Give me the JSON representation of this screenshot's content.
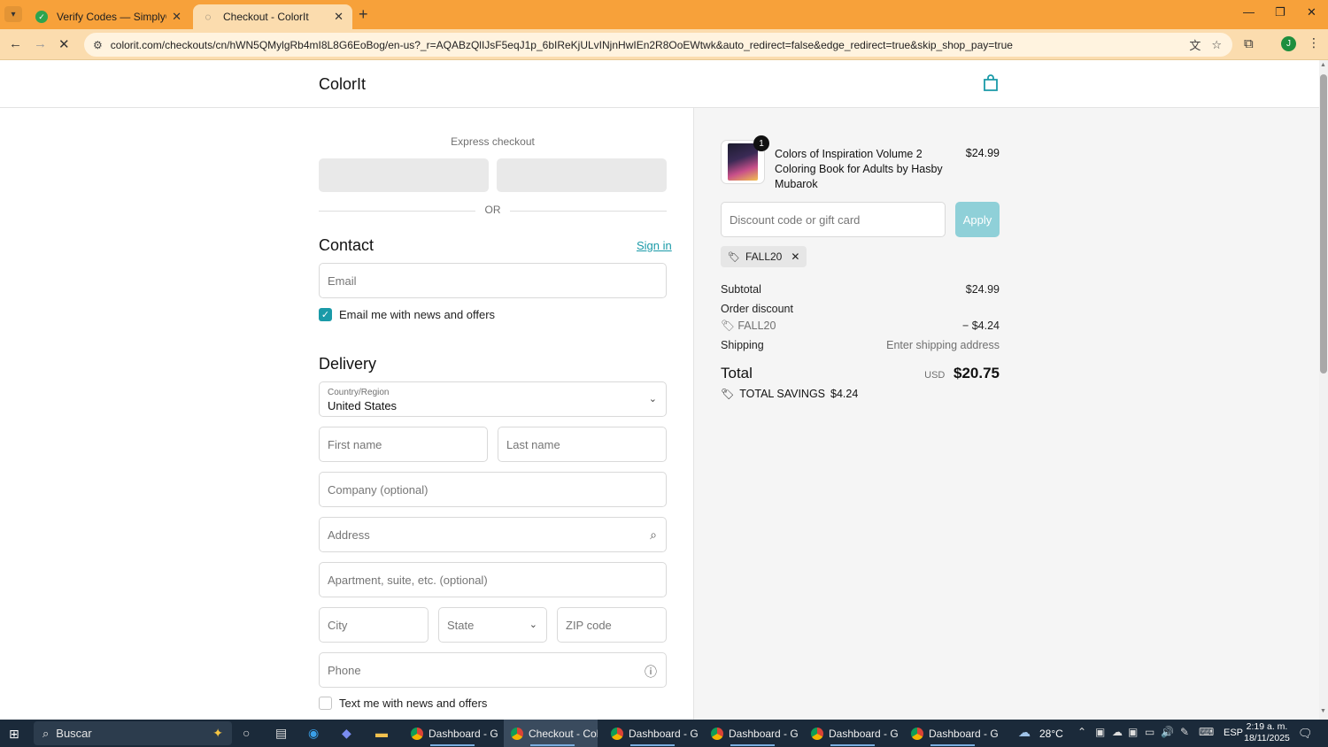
{
  "browser": {
    "tabs": [
      {
        "title": "Verify Codes — SimplyCodes",
        "favicon": "simplycodes-icon",
        "active": false
      },
      {
        "title": "Checkout - ColorIt",
        "favicon": "loading-icon",
        "active": true
      }
    ],
    "url": "colorit.com/checkouts/cn/hWN5QMylgRb4mI8L8G6EoBog/en-us?_r=AQABzQlIJsF5eqJ1p_6bIReKjULvINjnHwIEn2R8OoEWtwk&auto_redirect=false&edge_redirect=true&skip_shop_pay=true",
    "profile_initial": "J"
  },
  "header": {
    "shop_name": "ColorIt"
  },
  "express": {
    "title": "Express checkout",
    "or": "OR"
  },
  "contact": {
    "title": "Contact",
    "signin": "Sign in",
    "email_placeholder": "Email",
    "newsletter_label": "Email me with news and offers",
    "newsletter_checked": true
  },
  "delivery": {
    "title": "Delivery",
    "country_label": "Country/Region",
    "country_value": "United States",
    "first_name_placeholder": "First name",
    "last_name_placeholder": "Last name",
    "company_placeholder": "Company (optional)",
    "address_placeholder": "Address",
    "apartment_placeholder": "Apartment, suite, etc. (optional)",
    "city_placeholder": "City",
    "state_label": "State",
    "zip_placeholder": "ZIP code",
    "phone_placeholder": "Phone",
    "sms_label": "Text me with news and offers",
    "sms_checked": false
  },
  "summary": {
    "product": {
      "name": "Colors of Inspiration Volume 2 Coloring Book for Adults by Hasby Mubarok",
      "price": "$24.99",
      "quantity": "1"
    },
    "discount_placeholder": "Discount code or gift card",
    "apply_label": "Apply",
    "applied_code": "FALL20",
    "subtotal_label": "Subtotal",
    "subtotal_value": "$24.99",
    "order_discount_label": "Order discount",
    "discount_code": "FALL20",
    "discount_value": "− $4.24",
    "shipping_label": "Shipping",
    "shipping_value": "Enter shipping address",
    "total_label": "Total",
    "total_currency": "USD",
    "total_value": "$20.75",
    "savings_label": "TOTAL SAVINGS",
    "savings_value": "$4.24"
  },
  "taskbar": {
    "search_label": "Buscar",
    "apps": [
      {
        "name": "Dashboard - Go...",
        "active": false
      },
      {
        "name": "Checkout - Colo...",
        "active": true
      },
      {
        "name": "Dashboard - Go...",
        "active": false
      },
      {
        "name": "Dashboard - Go...",
        "active": false
      },
      {
        "name": "Dashboard - Go...",
        "active": false
      },
      {
        "name": "Dashboard - Go...",
        "active": false
      }
    ],
    "weather": "28°C",
    "language": "ESP",
    "time": "2:19 a. m.",
    "date": "18/11/2025"
  },
  "colors": {
    "accent": "#1a9aa8",
    "apply_disabled": "#8fd0d8",
    "tabbar": "#f7a13a"
  }
}
